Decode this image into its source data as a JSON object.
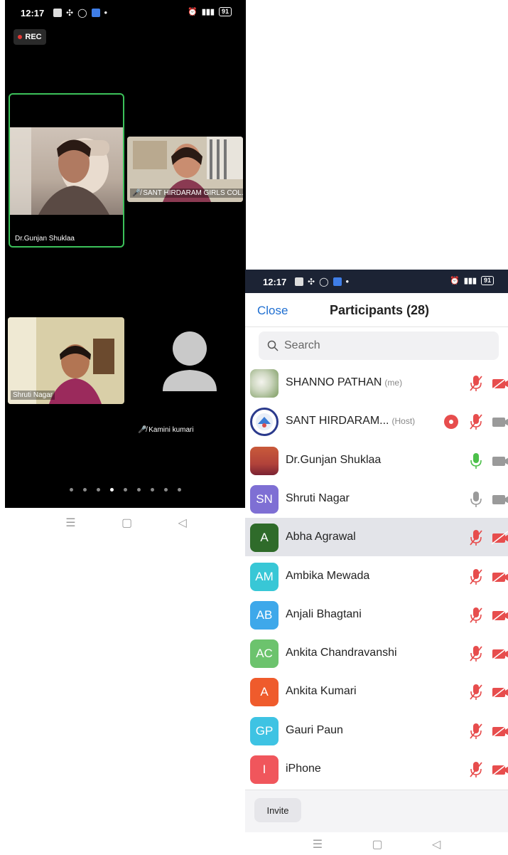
{
  "meeting_screen": {
    "status_bar": {
      "time": "12:17",
      "battery": "91"
    },
    "rec_label": "REC",
    "tiles": {
      "active_speaker": "Dr.Gunjan Shuklaa",
      "host_tile": "SANT HIRDARAM GIRLS COL...",
      "shruti_tile": "Shruti Nagar",
      "kamini_tile": "Kamini kumari"
    },
    "page_dots": {
      "count": 9,
      "active_index": 3
    }
  },
  "participants_screen": {
    "status_bar": {
      "time": "12:17",
      "battery": "91"
    },
    "close_label": "Close",
    "title": "Participants (28)",
    "search_placeholder": "Search",
    "participants": [
      {
        "name": "SHANNO PATHAN",
        "tag": "(me)",
        "avatar": "photo-flowers",
        "mic": "muted",
        "video": "off"
      },
      {
        "name": "SANT HIRDARAM...",
        "tag": "(Host)",
        "avatar": "college-logo",
        "recording": true,
        "mic": "muted",
        "video": "on"
      },
      {
        "name": "Dr.Gunjan Shuklaa",
        "tag": "",
        "avatar": "photo-person",
        "mic": "speaking",
        "video": "on"
      },
      {
        "name": "Shruti Nagar",
        "tag": "",
        "avatar_text": "SN",
        "avatar_color": "#7e6fd4",
        "mic": "unmuted",
        "video": "on"
      },
      {
        "name": "Abha Agrawal",
        "tag": "",
        "avatar_text": "A",
        "avatar_color": "#2f6b2a",
        "mic": "muted",
        "video": "off",
        "highlighted": true
      },
      {
        "name": "Ambika Mewada",
        "tag": "",
        "avatar_text": "AM",
        "avatar_color": "#38c7d6",
        "mic": "muted",
        "video": "off"
      },
      {
        "name": "Anjali Bhagtani",
        "tag": "",
        "avatar_text": "AB",
        "avatar_color": "#3ea8ea",
        "mic": "muted",
        "video": "off"
      },
      {
        "name": "Ankita Chandravanshi",
        "tag": "",
        "avatar_text": "AC",
        "avatar_color": "#6cc36d",
        "mic": "muted",
        "video": "off"
      },
      {
        "name": "Ankita Kumari",
        "tag": "",
        "avatar_text": "A",
        "avatar_color": "#ef5b2c",
        "mic": "muted",
        "video": "off"
      },
      {
        "name": "Gauri Paun",
        "tag": "",
        "avatar_text": "GP",
        "avatar_color": "#3ec3e3",
        "mic": "muted",
        "video": "off"
      },
      {
        "name": "iPhone",
        "tag": "",
        "avatar_text": "I",
        "avatar_color": "#f0565c",
        "mic": "muted",
        "video": "off"
      }
    ],
    "invite_label": "Invite"
  },
  "colors": {
    "accent_blue": "#1f6fd1",
    "active_green": "#3cc15a",
    "muted_red": "#e74d4d"
  }
}
